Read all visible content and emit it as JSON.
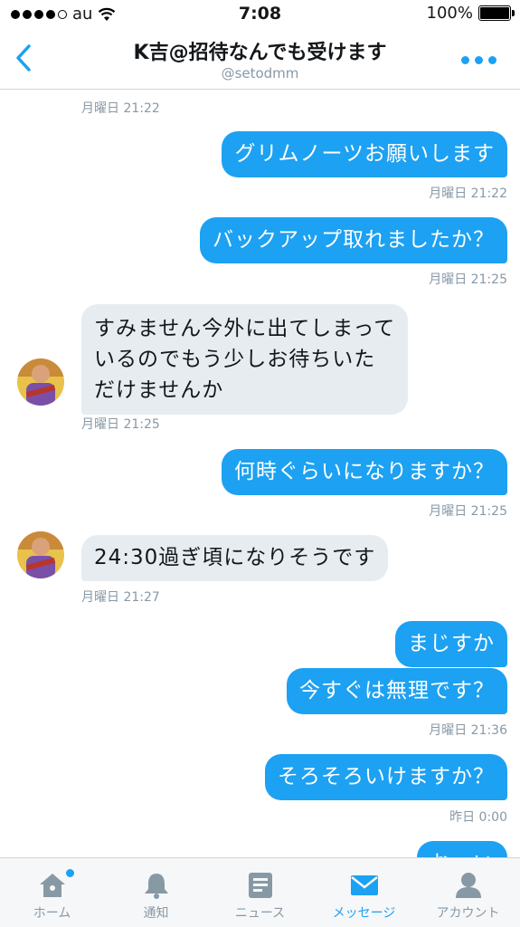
{
  "status": {
    "carrier": "au",
    "time": "7:08",
    "battery": "100%"
  },
  "header": {
    "title": "K吉@招待なんでも受けます",
    "handle": "@setodmm"
  },
  "messages": [
    {
      "text": "グリムノーツお願いします",
      "ts": "月曜日 21:22"
    },
    {
      "text": "バックアップ取れましたか？",
      "ts": "月曜日 21:25"
    },
    {
      "lines": [
        "すみません今外に出てしまって",
        "いるのでもう少しお待ちいた",
        "だけませんか"
      ],
      "ts": "月曜日 21:25"
    },
    {
      "text": "何時ぐらいになりますか？",
      "ts": "月曜日 21:25"
    },
    {
      "text": "24:30過ぎ頃になりそうです",
      "ts": "月曜日 21:27"
    },
    {
      "text": "まじすか"
    },
    {
      "text": "今すぐは無理です？",
      "ts": "月曜日 21:36"
    },
    {
      "text": "そろそろいけますか？",
      "ts": "昨日 0:00"
    },
    {
      "text": "おーい"
    }
  ],
  "top_ts": "月曜日 21:22",
  "tabs": [
    {
      "label": "ホーム",
      "icon": "home-icon"
    },
    {
      "label": "通知",
      "icon": "bell-icon"
    },
    {
      "label": "ニュース",
      "icon": "news-icon"
    },
    {
      "label": "メッセージ",
      "icon": "envelope-icon"
    },
    {
      "label": "アカウント",
      "icon": "person-icon"
    }
  ],
  "colors": {
    "accent": "#1da1f2",
    "received_bubble": "#e6ecf0",
    "muted": "#8899a6"
  }
}
